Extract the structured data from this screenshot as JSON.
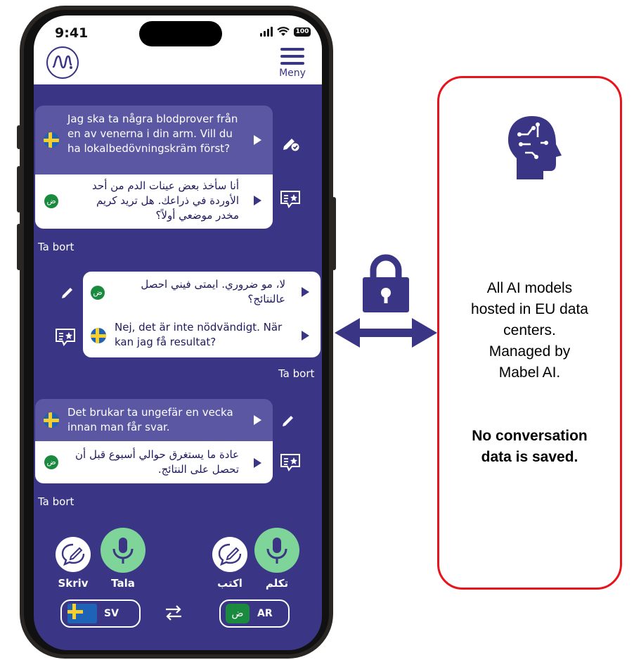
{
  "status_bar": {
    "time": "9:41",
    "battery": "100"
  },
  "header": {
    "menu_label": "Meny"
  },
  "conversation": [
    {
      "source_text": "Jag ska ta några blodprover från en av venerna i din arm. Vill du ha lokalbedövningskräm först?",
      "translation_text": "أنا سأخذ بعض عينات الدم من أحد الأوردة في ذراعك. هل تريد كريم مخدر موضعي أولاً؟",
      "remove_label": "Ta bort"
    },
    {
      "source_text": "لا، مو ضروري. ايمتى فيني احصل عالنتائج؟",
      "translation_text": "Nej, det är inte nödvändigt. När kan jag få resultat?",
      "remove_label": "Ta bort"
    },
    {
      "source_text": "Det brukar ta ungefär en vecka innan man får svar.",
      "translation_text": "عادة ما يستغرق حوالي أسبوع قبل أن تحصل على النتائج.",
      "remove_label": "Ta bort"
    }
  ],
  "controls": {
    "left": {
      "write_label": "Skriv",
      "speak_label": "Tala",
      "lang_code": "SV"
    },
    "right": {
      "write_label": "اكتب",
      "speak_label": "تكلم",
      "lang_code": "AR",
      "flag_letter": "ض"
    }
  },
  "info_panel": {
    "lines": [
      "All AI models",
      "hosted in EU data",
      "centers.",
      "Managed by",
      "Mabel AI."
    ],
    "bold_lines": [
      "No conversation",
      "data is saved."
    ]
  },
  "colors": {
    "app_purple": "#3a3585",
    "card_purple": "#5b57a2",
    "mic_green": "#7fd49a",
    "panel_border": "#e8141c"
  },
  "icons": [
    "ai-head-icon",
    "padlock-icon",
    "double-arrow-icon",
    "swap-icon",
    "mic-icon",
    "chat-write-icon"
  ]
}
